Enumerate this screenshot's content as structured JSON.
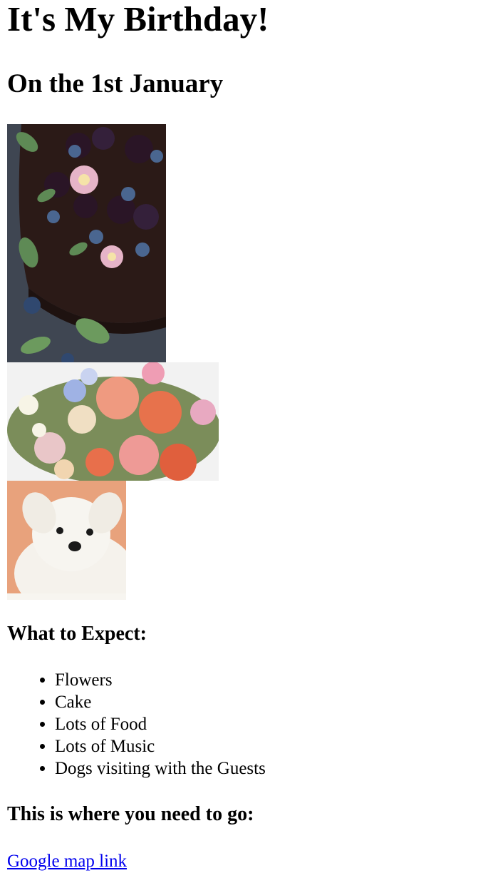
{
  "page": {
    "title": "It's My Birthday!",
    "subtitle": "On the 1st January"
  },
  "images": {
    "cake": "cake-image",
    "flowers": "flowers-image",
    "puppy": "puppy-image"
  },
  "expect": {
    "heading": "What to Expect:",
    "items": [
      "Flowers",
      "Cake",
      "Lots of Food",
      "Lots of Music",
      "Dogs visiting with the Guests"
    ]
  },
  "location": {
    "heading": "This is where you need to go:",
    "link_text": "Google map link"
  },
  "colors": {
    "link": "#0000ee",
    "text": "#000000"
  }
}
